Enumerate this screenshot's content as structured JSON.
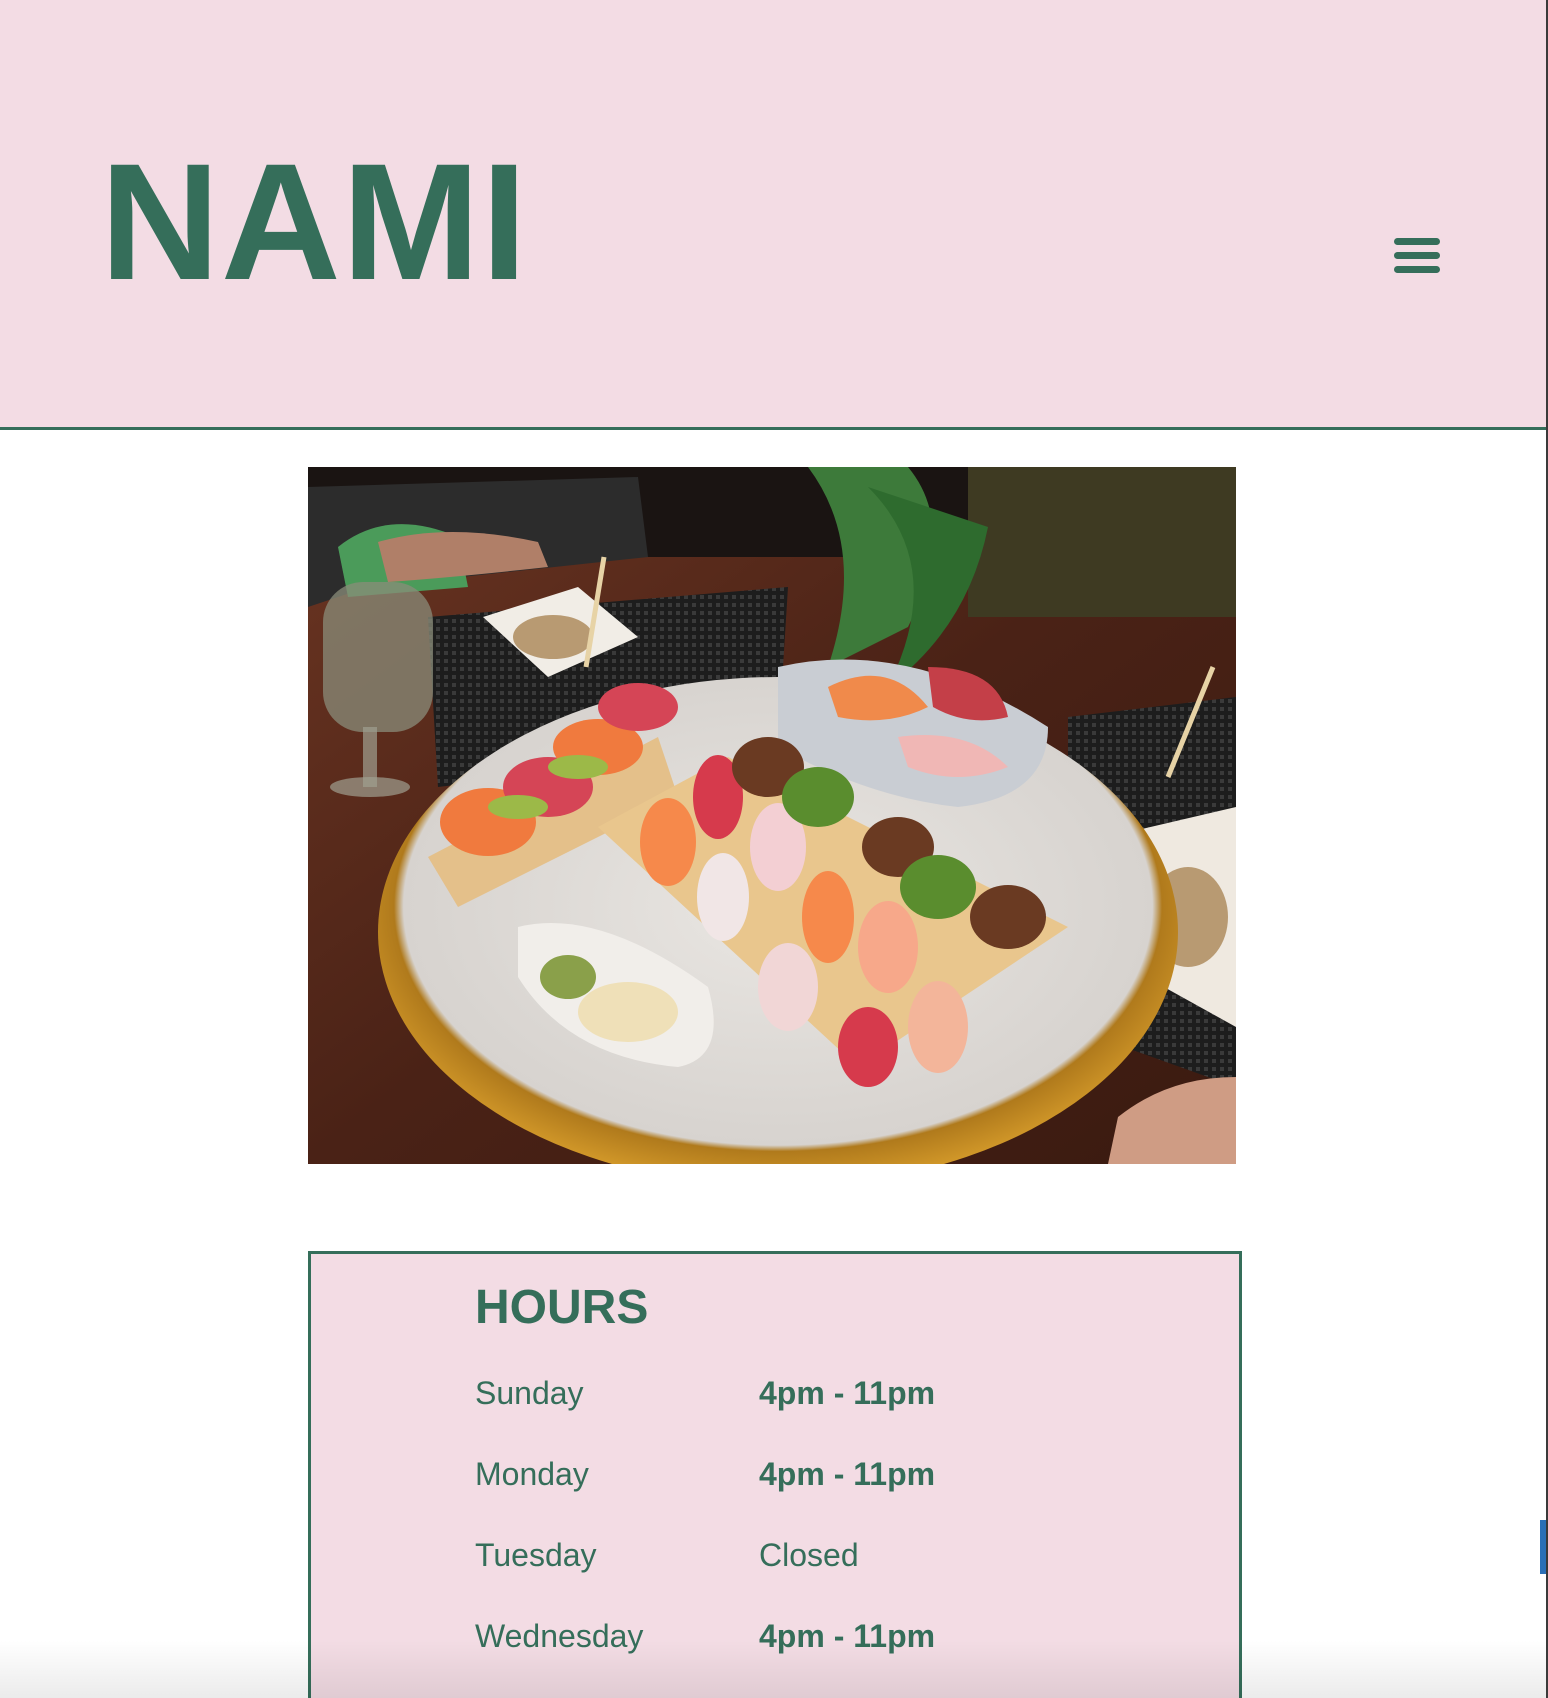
{
  "header": {
    "logo_text": "NAMI",
    "menu_icon": "hamburger-menu-icon"
  },
  "hero": {
    "image_subject": "sushi platter"
  },
  "hours": {
    "title": "HOURS",
    "rows": [
      {
        "day": "Sunday",
        "time": "4pm - 11pm"
      },
      {
        "day": "Monday",
        "time": "4pm - 11pm"
      },
      {
        "day": "Tuesday",
        "time": "Closed"
      },
      {
        "day": "Wednesday",
        "time": "4pm - 11pm"
      }
    ]
  },
  "colors": {
    "brand_green": "#356e5a",
    "header_pink": "#f3dce4",
    "background": "#ffffff"
  }
}
